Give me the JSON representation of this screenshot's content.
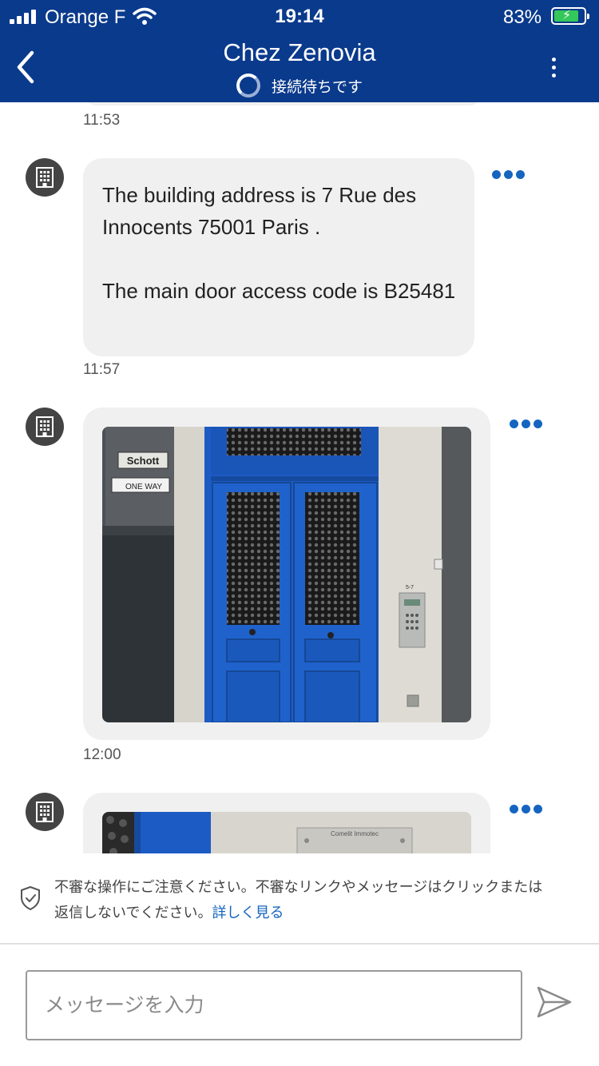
{
  "status_bar": {
    "carrier": "Orange F",
    "time": "19:14",
    "battery_percent": "83%",
    "battery_level": 0.83,
    "charging": true
  },
  "header": {
    "title": "Chez Zenovia",
    "connection_status": "接続待ちです",
    "background_color": "#0a3a8c"
  },
  "messages": [
    {
      "type": "text",
      "time": "11:53"
    },
    {
      "type": "text",
      "paragraph1": "The building address is 7 Rue des Innocents 75001 Paris .",
      "paragraph2": "The main door access code is B25481",
      "time": "11:57"
    },
    {
      "type": "image",
      "image_text_sign": "Schott",
      "image_text_oneway": "ONE WAY",
      "image_text_number": "5-7",
      "time": "12:00"
    },
    {
      "type": "image",
      "image_text_plate": "Comelit Immotec"
    }
  ],
  "warning": {
    "text": "不審な操作にご注意ください。不審なリンクやメッセージはクリックまたは返信しないでください。",
    "link_label": "詳しく見る"
  },
  "composer": {
    "placeholder": "メッセージを入力"
  },
  "icons": {
    "back": "chevron-left-icon",
    "menu": "vertical-dots-icon",
    "avatar": "building-icon",
    "more": "more-dots-icon",
    "shield": "shield-check-icon",
    "send": "send-icon"
  },
  "colors": {
    "accent": "#1565c0",
    "bubble": "#f0f0f0",
    "door_blue": "#1d5bc4"
  }
}
